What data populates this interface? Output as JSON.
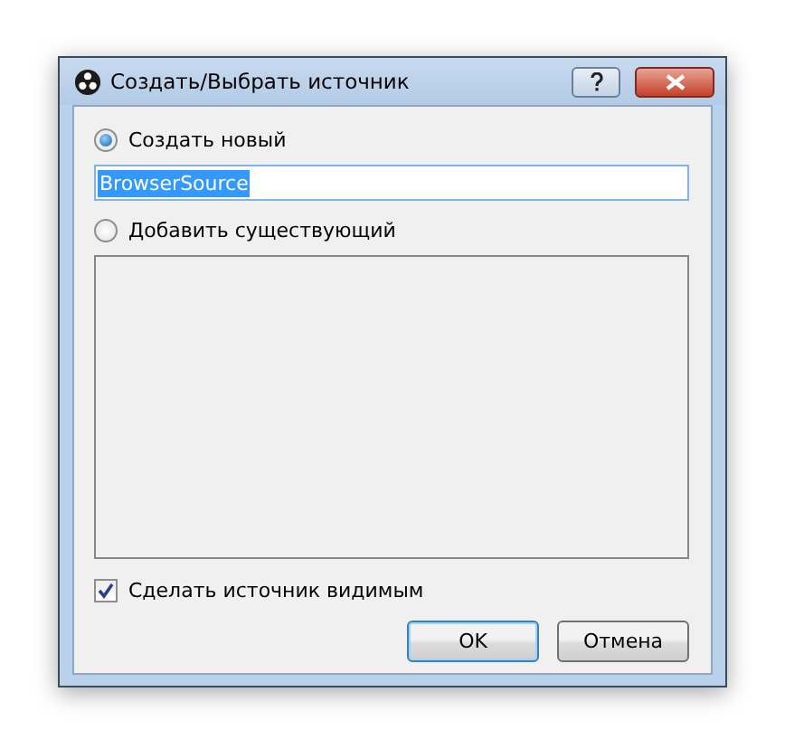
{
  "window": {
    "title": "Создать/Выбрать источник"
  },
  "options": [
    {
      "label": "Создать новый",
      "selected": true
    },
    {
      "label": "Добавить существующий",
      "selected": false
    }
  ],
  "name_field": {
    "value": "BrowserSource",
    "text_selected": true
  },
  "visible_checkbox": {
    "label": "Сделать источник видимым",
    "checked": true
  },
  "buttons": [
    {
      "label": "OK",
      "default": true
    },
    {
      "label": "Отмена",
      "default": false
    }
  ]
}
